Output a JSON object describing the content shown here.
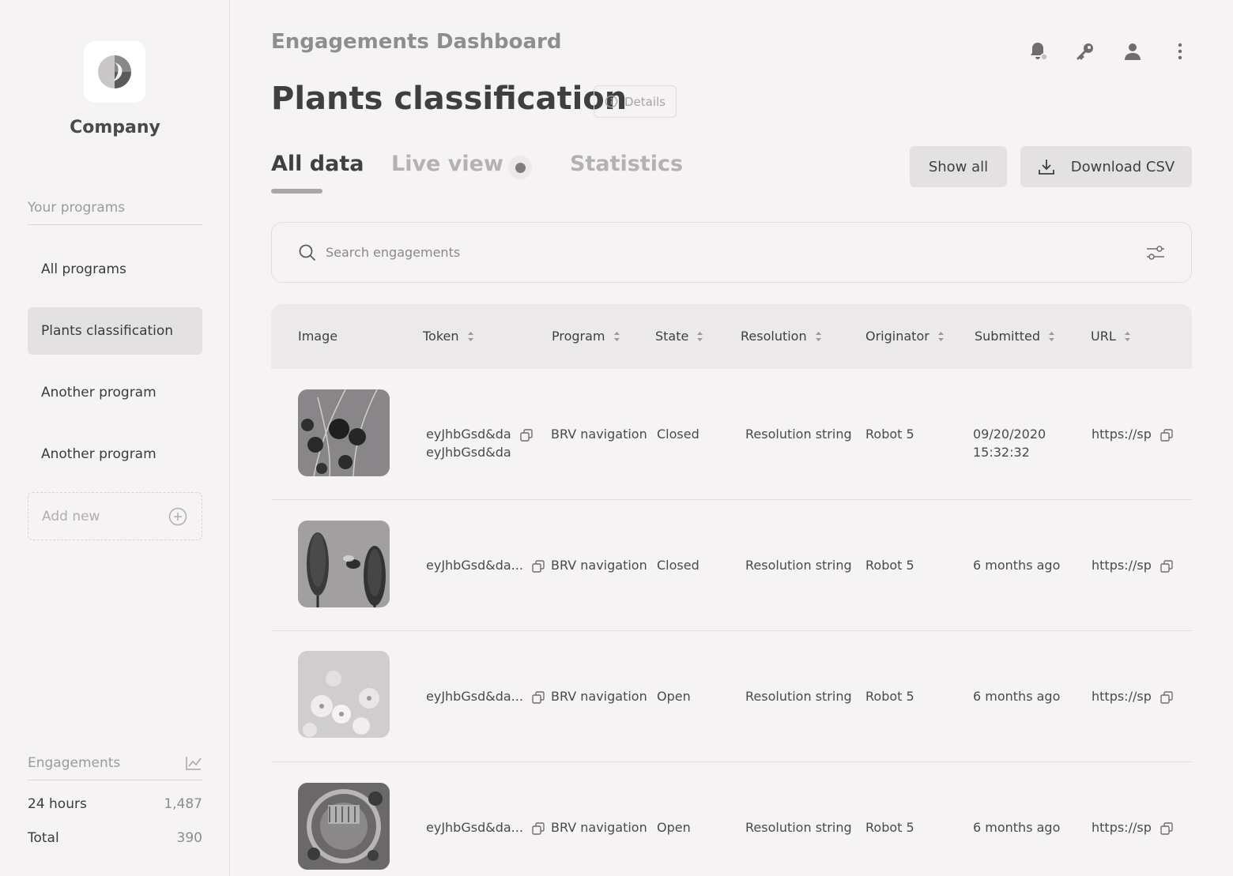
{
  "sidebar": {
    "company": "Company",
    "programs_label": "Your programs",
    "items": [
      {
        "label": "All programs",
        "active": false
      },
      {
        "label": "Plants classification",
        "active": true
      },
      {
        "label": "Another program",
        "active": false
      },
      {
        "label": "Another program",
        "active": false
      }
    ],
    "add_new": "Add new",
    "engagements_label": "Engagements",
    "stats": [
      {
        "label": "24 hours",
        "value": "1,487"
      },
      {
        "label": "Total",
        "value": "390"
      }
    ]
  },
  "header": {
    "breadcrumb": "Engagements Dashboard",
    "title": "Plants classification",
    "details": "Details",
    "icons": [
      "bell-icon",
      "key-icon",
      "user-icon",
      "more-vertical-icon"
    ]
  },
  "tabs": {
    "all": "All data",
    "live": "Live view",
    "stats": "Statistics"
  },
  "actions": {
    "show_all": "Show all",
    "download": "Download CSV"
  },
  "search": {
    "placeholder": "Search engagements"
  },
  "table": {
    "headers": {
      "image": "Image",
      "token": "Token",
      "program": "Program",
      "state": "State",
      "resolution": "Resolution",
      "originator": "Originator",
      "submitted": "Submitted",
      "url": "URL"
    },
    "rows": [
      {
        "token_1": "eyJhbGsd&da",
        "token_2": "eyJhbGsd&da",
        "program": "BRV navigation",
        "state": "Closed",
        "resolution": "Resolution string",
        "originator": "Robot 5",
        "submitted_1": "09/20/2020",
        "submitted_2": "15:32:32",
        "url": "https://sp"
      },
      {
        "token_1": "eyJhbGsd&da...",
        "token_2": "",
        "program": "BRV navigation",
        "state": "Closed",
        "resolution": "Resolution string",
        "originator": "Robot 5",
        "submitted_1": "6 months ago",
        "submitted_2": "",
        "url": "https://sp"
      },
      {
        "token_1": "eyJhbGsd&da...",
        "token_2": "",
        "program": "BRV navigation",
        "state": "Open",
        "resolution": "Resolution string",
        "originator": "Robot 5",
        "submitted_1": "6 months ago",
        "submitted_2": "",
        "url": "https://sp"
      },
      {
        "token_1": "eyJhbGsd&da...",
        "token_2": "",
        "program": "BRV navigation",
        "state": "Open",
        "resolution": "Resolution string",
        "originator": "Robot 5",
        "submitted_1": "6 months ago",
        "submitted_2": "",
        "url": "https://sp"
      }
    ]
  }
}
